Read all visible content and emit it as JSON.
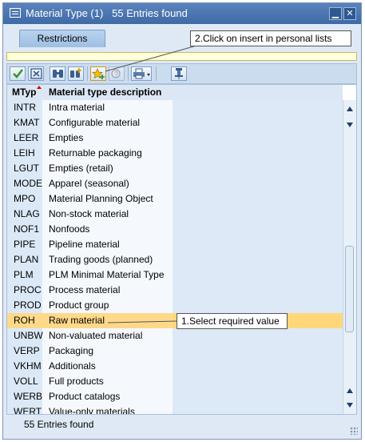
{
  "window": {
    "title": "Material Type (1)   55 Entries found",
    "minimize_glyph": "▁",
    "close_glyph": "✕"
  },
  "tabs": [
    {
      "label": "Restrictions",
      "active": true
    }
  ],
  "toolbar": {
    "buttons": [
      {
        "name": "continue-button",
        "icon": "checkmark-icon"
      },
      {
        "name": "cancel-button",
        "icon": "close-box-icon"
      },
      {
        "name": "find-button",
        "icon": "binoculars-icon"
      },
      {
        "name": "find-next-button",
        "icon": "binoculars-plus-icon"
      },
      {
        "name": "insert-personal-list-button",
        "icon": "star-plus-icon"
      },
      {
        "name": "information-button",
        "icon": "help-icon"
      },
      {
        "name": "print-button",
        "icon": "printer-icon"
      },
      {
        "name": "technical-info-button",
        "icon": "pin-icon"
      }
    ]
  },
  "table": {
    "columns": [
      {
        "label": "MTyp",
        "sorted": true
      },
      {
        "label": "Material type description"
      }
    ],
    "rows": [
      {
        "key": "INTR",
        "desc": "Intra material"
      },
      {
        "key": "KMAT",
        "desc": "Configurable material"
      },
      {
        "key": "LEER",
        "desc": "Empties"
      },
      {
        "key": "LEIH",
        "desc": "Returnable packaging"
      },
      {
        "key": "LGUT",
        "desc": "Empties (retail)"
      },
      {
        "key": "MODE",
        "desc": "Apparel (seasonal)"
      },
      {
        "key": "MPO",
        "desc": "Material Planning Object"
      },
      {
        "key": "NLAG",
        "desc": "Non-stock material"
      },
      {
        "key": "NOF1",
        "desc": "Nonfoods"
      },
      {
        "key": "PIPE",
        "desc": "Pipeline material"
      },
      {
        "key": "PLAN",
        "desc": "Trading goods (planned)"
      },
      {
        "key": "PLM",
        "desc": "PLM Minimal Material Type"
      },
      {
        "key": "PROC",
        "desc": "Process material"
      },
      {
        "key": "PROD",
        "desc": "Product group"
      },
      {
        "key": "ROH",
        "desc": "Raw material",
        "selected": true
      },
      {
        "key": "UNBW",
        "desc": "Non-valuated material"
      },
      {
        "key": "VERP",
        "desc": "Packaging"
      },
      {
        "key": "VKHM",
        "desc": "Additionals"
      },
      {
        "key": "VOLL",
        "desc": "Full products"
      },
      {
        "key": "WERB",
        "desc": "Product catalogs"
      },
      {
        "key": "WERT",
        "desc": "Value-only materials"
      }
    ],
    "selected_key": "ROH"
  },
  "status": {
    "text": "55 Entries found"
  },
  "annotations": {
    "insert": "2.Click on insert in personal lists",
    "select": "1.Select required value"
  },
  "colors": {
    "titlebar": "#4a74ae",
    "selection": "#ffd77a",
    "key_column": "#dbe9f7",
    "window_bg": "#dfe9f5"
  }
}
